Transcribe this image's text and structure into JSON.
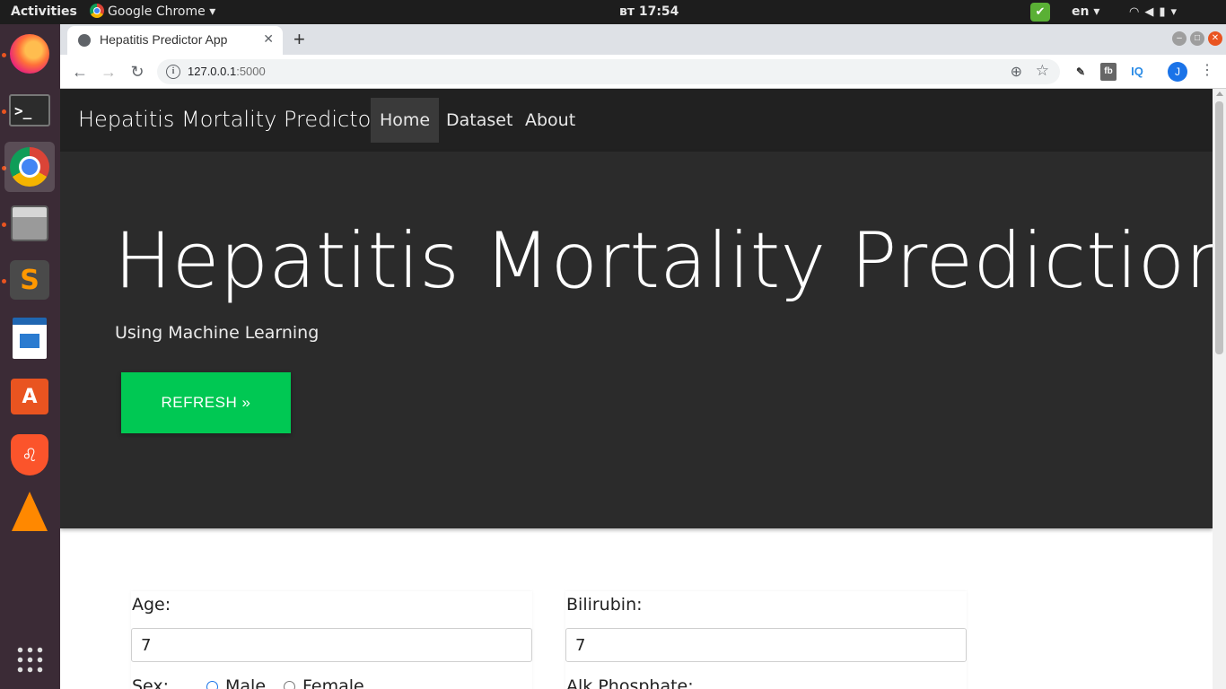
{
  "topbar": {
    "activities": "Activities",
    "app_name": "Google Chrome",
    "clock": "вт 17:54",
    "lang": "en"
  },
  "dock": {
    "items": [
      "firefox-icon",
      "terminal-icon",
      "chrome-icon",
      "files-icon",
      "sublime-text-icon",
      "libreoffice-writer-icon",
      "software-center-icon",
      "brave-icon",
      "vlc-icon",
      "show-apps-icon"
    ]
  },
  "browser": {
    "tab_title": "Hepatitis Predictor App",
    "url_host": "127.0.0.1",
    "url_port": ":5000",
    "avatar_initial": "J",
    "ext_2": "fb",
    "ext_3": "IQ"
  },
  "site": {
    "brand": "Hepatitis Mortality Predictor",
    "nav": {
      "home": "Home",
      "dataset": "Dataset",
      "about": "About"
    },
    "hero": {
      "title": "Hepatitis Mortality Prediction",
      "subtitle": "Using Machine Learning",
      "refresh_label": "REFRESH »"
    },
    "form": {
      "age_label": "Age:",
      "age_value": "7",
      "bilirubin_label": "Bilirubin:",
      "bilirubin_value": "7",
      "sex_label": "Sex:",
      "sex_options": [
        "Male",
        "Female"
      ],
      "alk_label": "Alk Phosphate:"
    }
  },
  "colors": {
    "accent_green": "#00c853",
    "navbar_bg": "#212121",
    "hero_bg": "#2b2b2b",
    "dock_bg": "#3b2b36"
  }
}
